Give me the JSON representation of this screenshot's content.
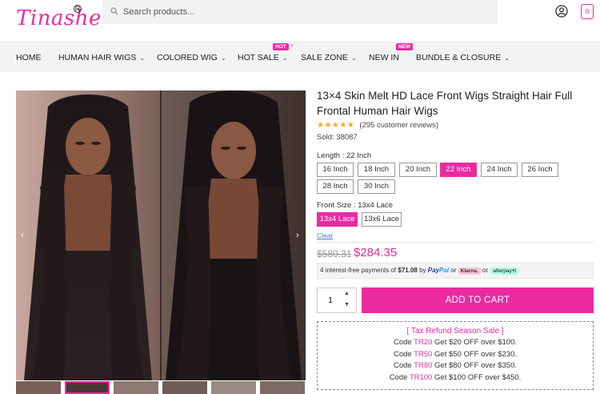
{
  "brand": {
    "logo_text": "Tinashe"
  },
  "search": {
    "placeholder": "Search products..."
  },
  "cart": {
    "count": "0"
  },
  "nav": {
    "items": [
      {
        "label": "HOME",
        "chevron": false
      },
      {
        "label": "HUMAN HAIR WIGS",
        "chevron": true
      },
      {
        "label": "COLORED WIG",
        "chevron": true
      },
      {
        "label": "HOT SALE",
        "chevron": true,
        "badge": "HOT"
      },
      {
        "label": "SALE ZONE",
        "chevron": true
      },
      {
        "label": "NEW IN",
        "chevron": false,
        "badge": "NEW"
      },
      {
        "label": "BUNDLE & CLOSURE",
        "chevron": true
      }
    ]
  },
  "product": {
    "title": "13×4 Skin Melt HD Lace Front Wigs Straight Hair Full Frontal Human Hair Wigs",
    "stars": "★★★★★",
    "reviews": "(295 customer reviews)",
    "sold": "Sold: 38087",
    "length_label": "Length : 22 Inch",
    "lengths": [
      "16 Inch",
      "18 Inch",
      "20 Inch",
      "22 Inch",
      "24 Inch",
      "26 Inch",
      "28 Inch",
      "30 Inch"
    ],
    "length_selected": "22 Inch",
    "front_label": "Front Size : 13x4 Lace",
    "fronts": [
      "13x4 Lace",
      "13x6 Lace"
    ],
    "front_selected": "13x4 Lace",
    "clear": "Clear",
    "price_old": "$580.31",
    "price_new": "$284.35",
    "installments": {
      "prefix": "4 interest-free payments of",
      "amount": "$71.08",
      "by": "by",
      "paypal": "Pay",
      "paypal2": "Pal",
      "or1": "or",
      "klarna": "Klarna.",
      "or2": "or",
      "afterpay": "afterpay⟲"
    },
    "quantity": "1",
    "add_to_cart": "ADD TO CART"
  },
  "promo": {
    "title": "[ Tax Refund Season Sale ]",
    "lines": [
      {
        "pre": "Code",
        "code": "TR20",
        "post": "Get $20 OFF over $100."
      },
      {
        "pre": "Code",
        "code": "TR50",
        "post": "Get $50 OFF over $230."
      },
      {
        "pre": "Code",
        "code": "TR80",
        "post": "Get $80 OFF over $350."
      },
      {
        "pre": "Code",
        "code": "TR100",
        "post": "Get $100 OFF over $450."
      }
    ]
  },
  "icons": {
    "search": "search-icon",
    "account": "account-icon",
    "cart": "cart-icon",
    "prev": "chevron-left-icon",
    "next": "chevron-right-icon"
  },
  "colors": {
    "accent": "#ec2aa0",
    "nav_bg": "#f3f3f3"
  }
}
